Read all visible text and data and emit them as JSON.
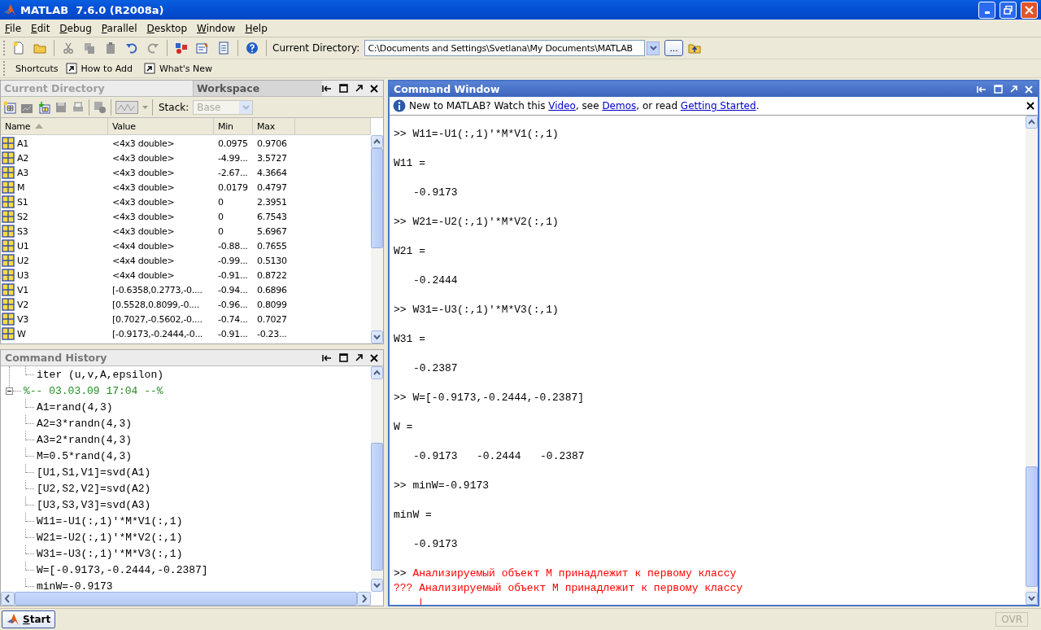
{
  "window": {
    "title": "MATLAB  7.6.0 (R2008a)"
  },
  "menu": [
    "File",
    "Edit",
    "Debug",
    "Parallel",
    "Desktop",
    "Window",
    "Help"
  ],
  "toolbar": {
    "directory_label": "Current Directory:",
    "directory": "C:\\Documents and Settings\\Svetlana\\My Documents\\MATLAB",
    "browse": "..."
  },
  "shortcuts": {
    "label": "Shortcuts",
    "items": [
      "How to Add",
      "What's New"
    ]
  },
  "workspace": {
    "tabs": [
      {
        "label": "Current Directory",
        "selected": false
      },
      {
        "label": "Workspace",
        "selected": true
      }
    ],
    "stack_label": "Stack:",
    "stack": "Base",
    "columns": [
      "Name",
      "Value",
      "Min",
      "Max"
    ],
    "rows": [
      {
        "name": "A1",
        "value": "<4x3 double>",
        "min": "0.0975",
        "max": "0.9706"
      },
      {
        "name": "A2",
        "value": "<4x3 double>",
        "min": "-4.99...",
        "max": "3.5727"
      },
      {
        "name": "A3",
        "value": "<4x3 double>",
        "min": "-2.67...",
        "max": "4.3664"
      },
      {
        "name": "M",
        "value": "<4x3 double>",
        "min": "0.0179",
        "max": "0.4797"
      },
      {
        "name": "S1",
        "value": "<4x3 double>",
        "min": "0",
        "max": "2.3951"
      },
      {
        "name": "S2",
        "value": "<4x3 double>",
        "min": "0",
        "max": "6.7543"
      },
      {
        "name": "S3",
        "value": "<4x3 double>",
        "min": "0",
        "max": "5.6967"
      },
      {
        "name": "U1",
        "value": "<4x4 double>",
        "min": "-0.88...",
        "max": "0.7655"
      },
      {
        "name": "U2",
        "value": "<4x4 double>",
        "min": "-0.99...",
        "max": "0.5130"
      },
      {
        "name": "U3",
        "value": "<4x4 double>",
        "min": "-0.91...",
        "max": "0.8722"
      },
      {
        "name": "V1",
        "value": "[-0.6358,0.2773,-0....",
        "min": "-0.94...",
        "max": "0.6896"
      },
      {
        "name": "V2",
        "value": "[0.5528,0.8099,-0....",
        "min": "-0.96...",
        "max": "0.8099"
      },
      {
        "name": "V3",
        "value": "[0.7027,-0.5602,-0....",
        "min": "-0.74...",
        "max": "0.7027"
      },
      {
        "name": "W",
        "value": "[-0.9173,-0.2444,-0...",
        "min": "-0.91...",
        "max": "-0.23..."
      }
    ]
  },
  "history": {
    "title": "Command History",
    "entries": [
      {
        "kind": "command",
        "text": "iter (u,v,A,epsilon)"
      },
      {
        "kind": "session",
        "text": "%-- 03.03.09 17:04 --%",
        "expanded": true,
        "children": [
          {
            "kind": "command",
            "text": "A1=rand(4,3)"
          },
          {
            "kind": "command",
            "text": "A2=3*randn(4,3)"
          },
          {
            "kind": "command",
            "text": "A3=2*randn(4,3)"
          },
          {
            "kind": "command",
            "text": "M=0.5*rand(4,3)"
          },
          {
            "kind": "command",
            "text": "[U1,S1,V1]=svd(A1)"
          },
          {
            "kind": "command",
            "text": "[U2,S2,V2]=svd(A2)"
          },
          {
            "kind": "command",
            "text": "[U3,S3,V3]=svd(A3)"
          },
          {
            "kind": "command",
            "text": "W11=-U1(:,1)'*M*V1(:,1)"
          },
          {
            "kind": "command",
            "text": "W21=-U2(:,1)'*M*V2(:,1)"
          },
          {
            "kind": "command",
            "text": "W31=-U3(:,1)'*M*V3(:,1)"
          },
          {
            "kind": "command",
            "text": "W=[-0.9173,-0.2444,-0.2387]"
          },
          {
            "kind": "command",
            "text": "minW=-0.9173"
          }
        ]
      }
    ]
  },
  "command_window": {
    "title": "Command Window",
    "info": [
      {
        "text": "New to MATLAB? Watch this ",
        "link": false
      },
      {
        "text": "Video",
        "link": true
      },
      {
        "text": ", see ",
        "link": false
      },
      {
        "text": "Demos",
        "link": true
      },
      {
        "text": ", or read ",
        "link": false
      },
      {
        "text": "Getting Started",
        "link": true
      },
      {
        "text": ".",
        "link": false
      }
    ],
    "lines": [
      {
        "kind": "command",
        "prompt": ">>",
        "text": "W11=-U1(:,1)'*M*V1(:,1)"
      },
      {
        "kind": "output",
        "text": "W11 ="
      },
      {
        "kind": "value",
        "text": "-0.9173"
      },
      {
        "kind": "command",
        "prompt": ">>",
        "text": "W21=-U2(:,1)'*M*V2(:,1)"
      },
      {
        "kind": "output",
        "text": "W21 ="
      },
      {
        "kind": "value",
        "text": "-0.2444"
      },
      {
        "kind": "command",
        "prompt": ">>",
        "text": "W31=-U3(:,1)'*M*V3(:,1)"
      },
      {
        "kind": "output",
        "text": "W31 ="
      },
      {
        "kind": "value",
        "text": "-0.2387"
      },
      {
        "kind": "command",
        "prompt": ">>",
        "text": "W=[-0.9173,-0.2444,-0.2387]"
      },
      {
        "kind": "output",
        "text": "W ="
      },
      {
        "kind": "value",
        "text": "-0.9173   -0.2444   -0.2387"
      },
      {
        "kind": "command",
        "prompt": ">>",
        "text": "minW=-0.9173"
      },
      {
        "kind": "output",
        "text": "minW ="
      },
      {
        "kind": "value",
        "text": "-0.9173"
      },
      {
        "kind": "bad_command",
        "prompt": ">>",
        "text": "Анализируемый объект М принадлежит к первому классу"
      },
      {
        "kind": "error",
        "text": "??? Анализируемый объект М принадлежит к первому классу"
      }
    ]
  },
  "status_bar": {
    "start": "Start",
    "ovr": "OVR"
  }
}
